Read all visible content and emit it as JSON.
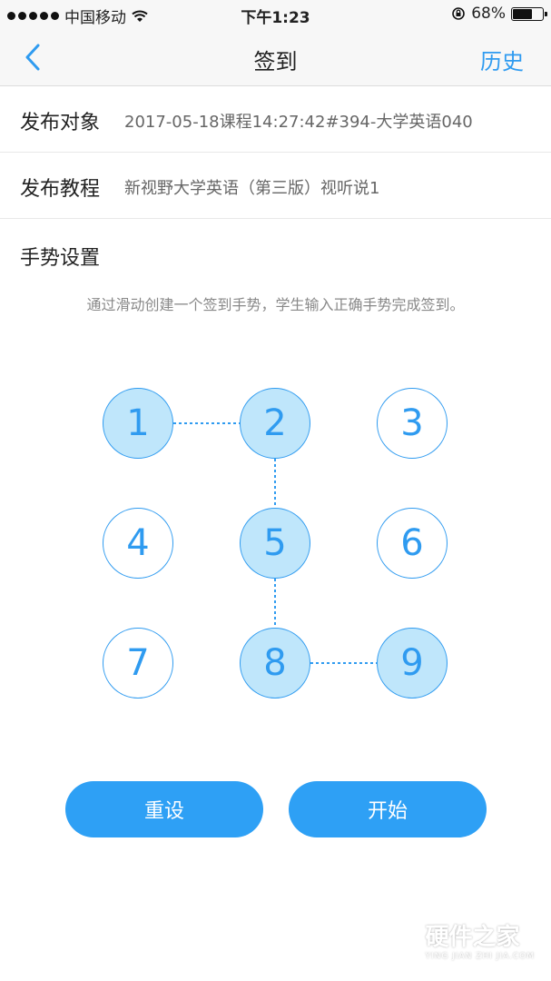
{
  "status_bar": {
    "carrier": "中国移动",
    "time": "下午1:23",
    "battery": "68%",
    "battery_level": 0.68
  },
  "nav": {
    "title": "签到",
    "history": "历史"
  },
  "rows": [
    {
      "label": "发布对象",
      "value": "2017-05-18课程14:27:42#394-大学英语040"
    },
    {
      "label": "发布教程",
      "value": "新视野大学英语（第三版）视听说1"
    }
  ],
  "gesture": {
    "section_title": "手势设置",
    "hint": "通过滑动创建一个签到手势，学生输入正确手势完成签到。",
    "nodes": [
      "1",
      "2",
      "3",
      "4",
      "5",
      "6",
      "7",
      "8",
      "9"
    ],
    "selected": [
      "1",
      "2",
      "5",
      "8",
      "9"
    ],
    "path": [
      "1",
      "2",
      "5",
      "8",
      "9"
    ]
  },
  "buttons": {
    "reset": "重设",
    "start": "开始"
  },
  "watermark": {
    "cn": "硬件之家",
    "en": "YING JIAN ZHI JIA.COM"
  },
  "colors": {
    "accent": "#2f9bf0",
    "selected_fill": "#bfe6fb",
    "button": "#2ea0f5"
  }
}
